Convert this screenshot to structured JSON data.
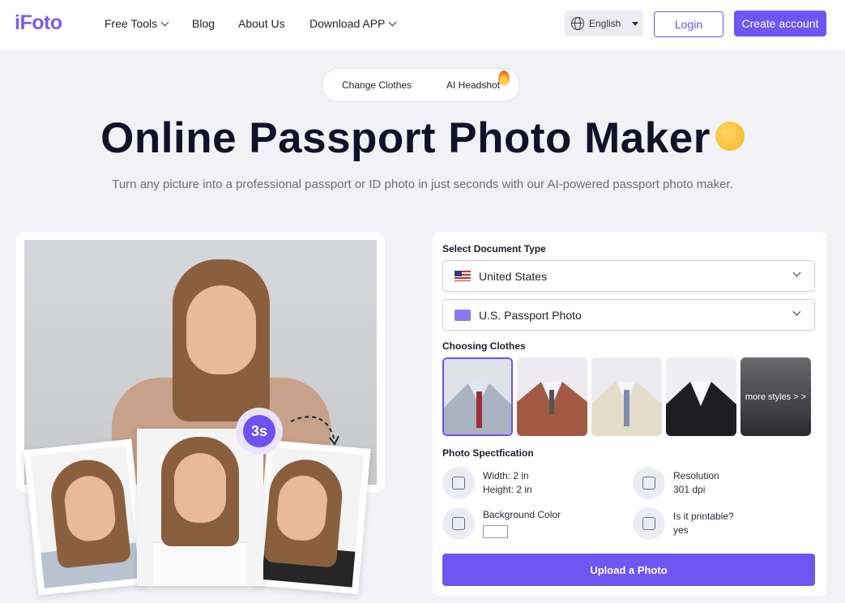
{
  "nav": {
    "logo": "iFoto",
    "links": [
      "Free Tools",
      "Blog",
      "About Us",
      "Download APP"
    ],
    "language": "English",
    "login": "Login",
    "create": "Create account"
  },
  "pills": [
    "Change Clothes",
    "AI Headshot"
  ],
  "hero": {
    "title": "Online Passport Photo Maker",
    "subtitle": "Turn any picture into a professional passport or ID photo in just seconds with our AI-powered passport photo maker.",
    "timer": "3s"
  },
  "form": {
    "doc_type_label": "Select Document Type",
    "country": "United States",
    "photo_type": "U.S. Passport Photo",
    "clothes_label": "Choosing Clothes",
    "more_styles": "more styles > >",
    "spec_label": "Photo Spectfication",
    "width": "Width: 2 in",
    "height": "Height: 2 in",
    "resolution_label": "Resolution",
    "resolution": "301 dpi",
    "bg_label": "Background Color",
    "printable_label": "Is it printable?",
    "printable": "yes",
    "upload": "Upload a Photo"
  },
  "colors": {
    "accent": "#6f55f2"
  }
}
